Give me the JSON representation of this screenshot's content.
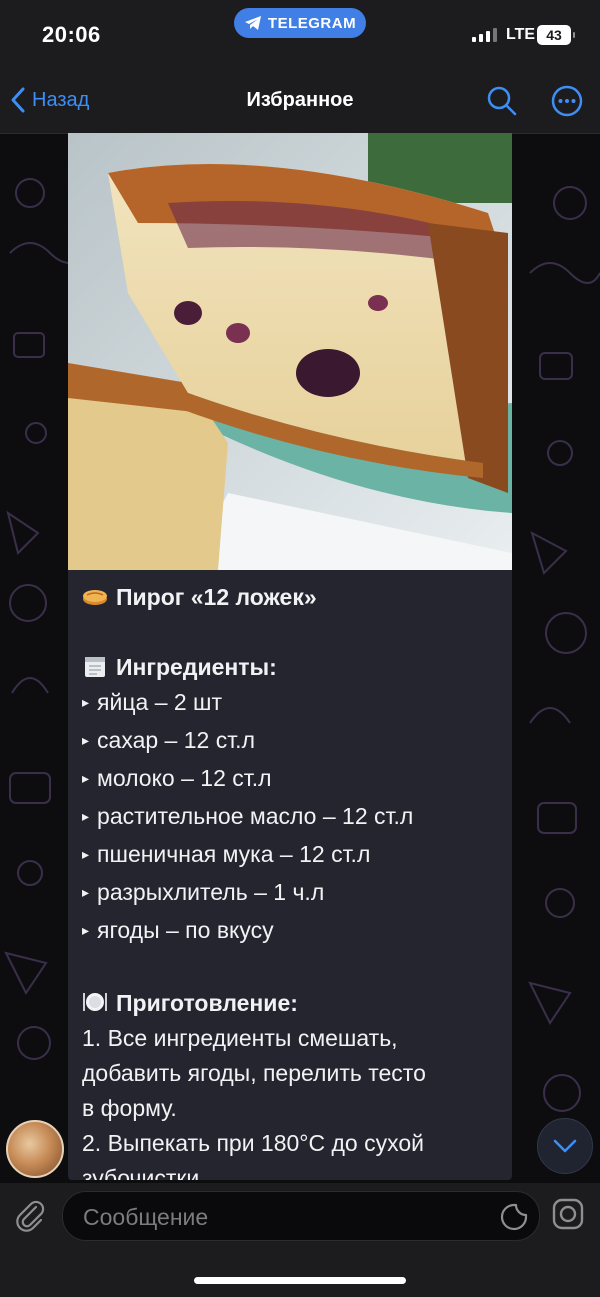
{
  "status": {
    "time": "20:06",
    "pill_label": "TELEGRAM",
    "network": "LTE",
    "battery": "43"
  },
  "nav": {
    "back_label": "Назад",
    "title": "Избранное"
  },
  "message": {
    "title": "Пирог «12 ложек»",
    "ingredients_heading": "Ингредиенты:",
    "ingredients": [
      "яйца – 2 шт",
      "сахар – 12 ст.л",
      "молоко – 12 ст.л",
      "растительное масло – 12 ст.л",
      "пшеничная мука – 12 ст.л",
      "разрыхлитель – 1 ч.л",
      "ягоды – по вкусу"
    ],
    "preparation_heading": "Приготовление:",
    "preparation": [
      "1. Все ингредиенты смешать,",
      "добавить ягоды, перелить тесто",
      "в форму.",
      "2. Выпекать при 180°C до сухой",
      "зубочистки."
    ]
  },
  "composer": {
    "placeholder": "Сообщение"
  },
  "colors": {
    "accent": "#3d8ef5",
    "pill": "#3f7fe6",
    "bubble": "#252530",
    "bar": "#1c1c1e"
  }
}
